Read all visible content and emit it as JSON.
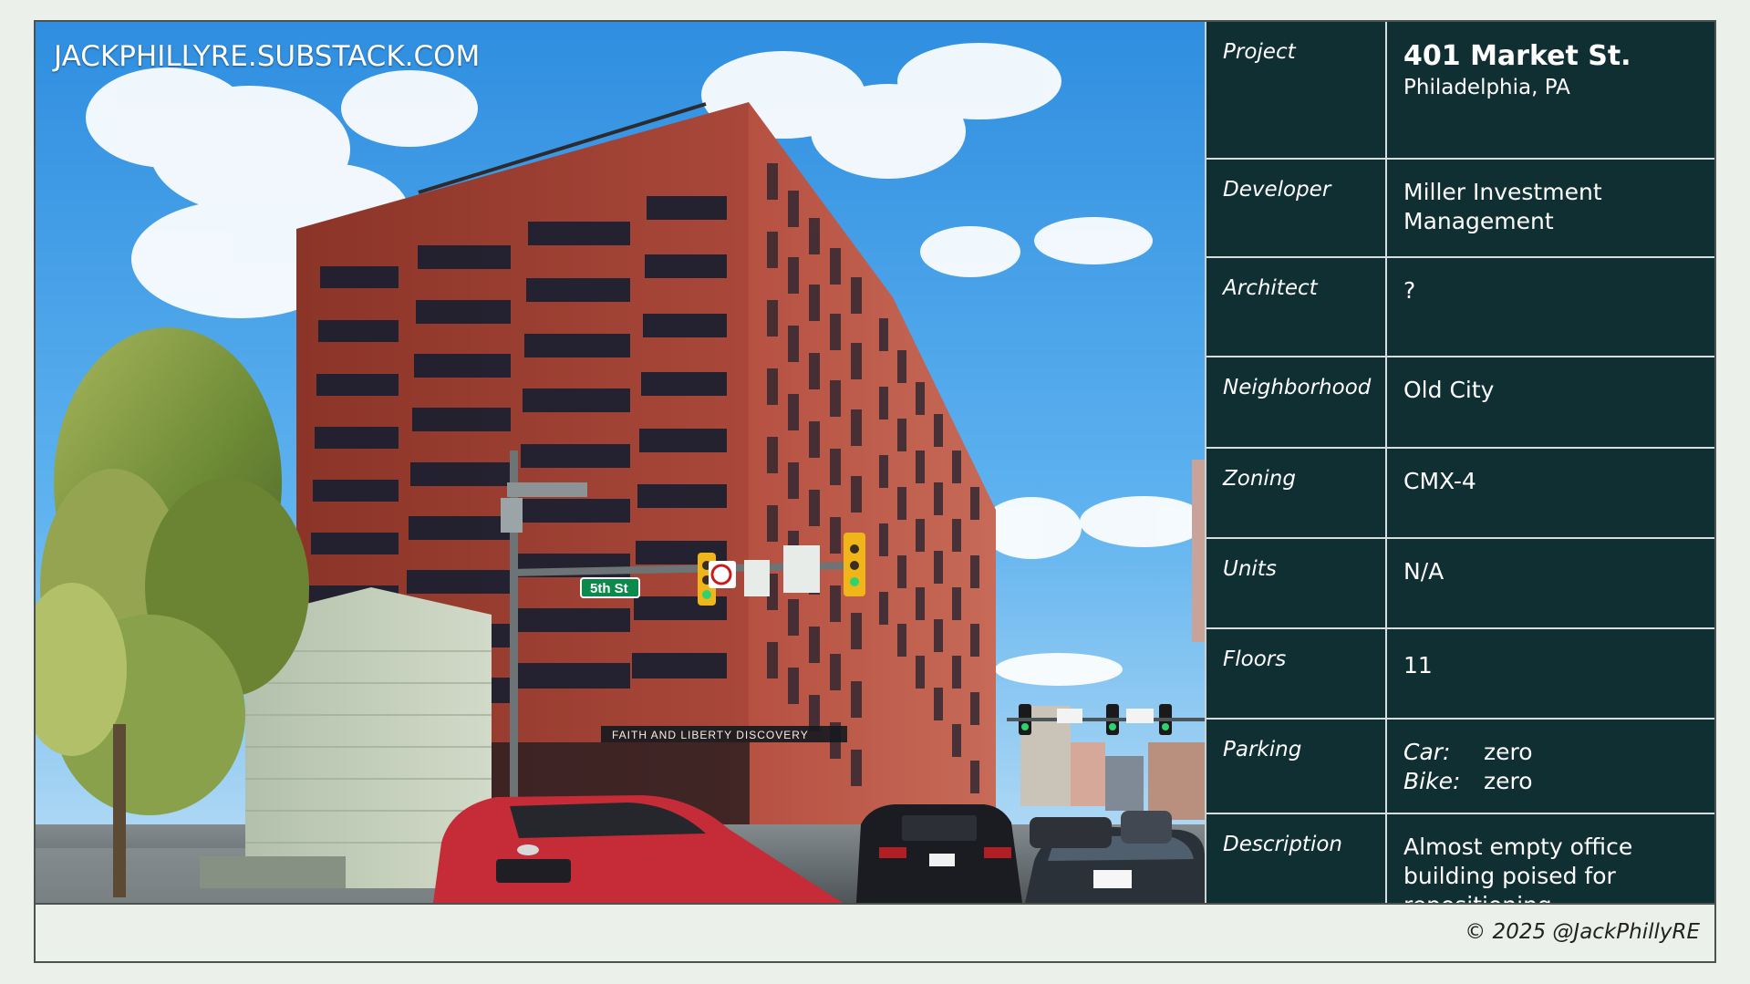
{
  "watermark": "JACKPHILLYRE.SUBSTACK.COM",
  "photo": {
    "street_sign": "5th St",
    "storefront_sign": "FAITH AND LIBERTY DISCOVERY",
    "street_sign_color": "#0c8a4b",
    "sky_color": "#4aa4e6",
    "building_color": "#9e3f32"
  },
  "details": {
    "project": {
      "label": "Project",
      "name": "401 Market St.",
      "location": "Philadelphia, PA"
    },
    "developer": {
      "label": "Developer",
      "value": "Miller Investment Management"
    },
    "architect": {
      "label": "Architect",
      "value": "?"
    },
    "neighborhood": {
      "label": "Neighborhood",
      "value": "Old City"
    },
    "zoning": {
      "label": "Zoning",
      "value": "CMX-4"
    },
    "units": {
      "label": "Units",
      "value": "N/A"
    },
    "floors": {
      "label": "Floors",
      "value": "11"
    },
    "parking": {
      "label": "Parking",
      "car_key": "Car:",
      "car_value": "zero",
      "bike_key": "Bike:",
      "bike_value": "zero"
    },
    "description": {
      "label": "Description",
      "value": "Almost empty office building poised for repositioning"
    }
  },
  "footer": {
    "copyright": "© 2025 @JackPhillyRE"
  },
  "colors": {
    "panel_background": "#0f2f33",
    "panel_text": "#ffffff",
    "page_background": "#ecf0ea"
  }
}
